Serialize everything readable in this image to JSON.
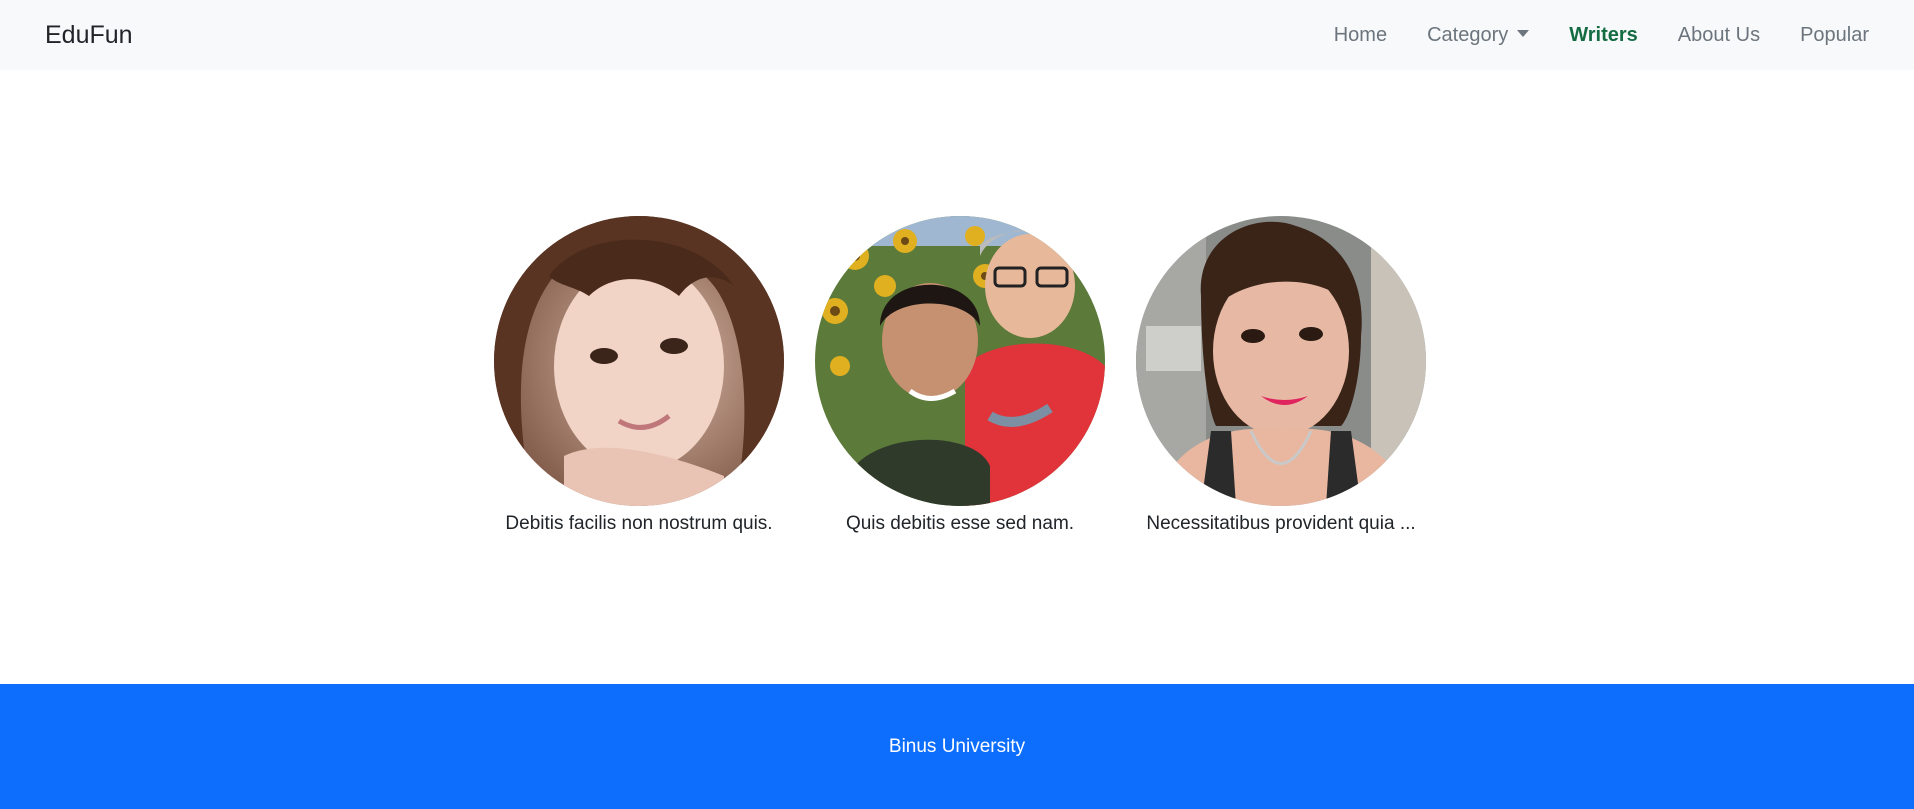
{
  "navbar": {
    "brand": "EduFun",
    "links": {
      "home": "Home",
      "category": "Category",
      "writers": "Writers",
      "about": "About Us",
      "popular": "Popular"
    },
    "active": "Writers",
    "active_color": "#146c43",
    "background": "#f8f9fa"
  },
  "writers": [
    {
      "name": "Debitis facilis non nostrum quis."
    },
    {
      "name": "Quis debitis esse sed nam."
    },
    {
      "name": "Necessitatibus provident quia ..."
    }
  ],
  "footer": {
    "text": "Binus University",
    "background": "#0d6efd"
  }
}
